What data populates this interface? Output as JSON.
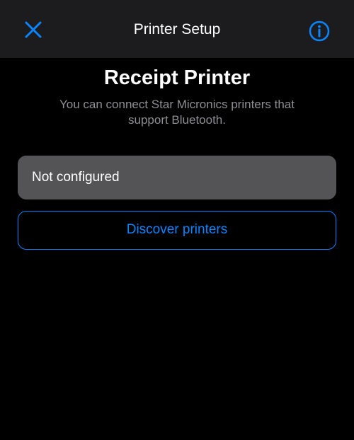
{
  "nav": {
    "title": "Printer Setup",
    "close_icon": "close-icon",
    "info_icon": "info-icon"
  },
  "main": {
    "heading": "Receipt Printer",
    "subtitle": "You can connect Star Micronics printers that support Bluetooth.",
    "status_value": "Not configured",
    "discover_label": "Discover printers"
  },
  "colors": {
    "accent": "#0a84ff",
    "background": "#000000",
    "nav_background": "#1c1c1e",
    "field_background": "#545456",
    "secondary_text": "#8e8e93"
  }
}
